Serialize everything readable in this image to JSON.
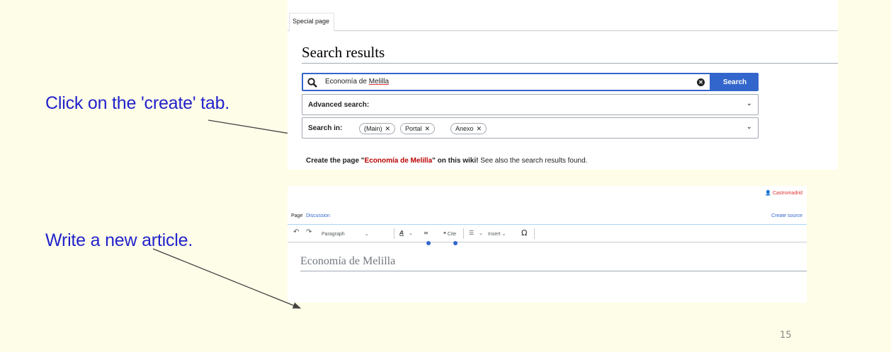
{
  "slide": {
    "caption_create": "Click on the 'create' tab.",
    "caption_write": "Write a new article.",
    "page_number": "15"
  },
  "search_screen": {
    "tab_label": "Special page",
    "heading": "Search results",
    "query_part1": "Economía de ",
    "query_part2": "Melilla",
    "search_button": "Search",
    "advanced_label": "Advanced search:",
    "search_in_label": "Search in:",
    "namespaces": [
      "(Main)",
      "Portal",
      "Anexo"
    ],
    "create_prefix": "Create the page \"",
    "create_link": "Economía de Melilla",
    "create_suffix": "\" on this wiki!",
    "create_tail": " See also the search results found."
  },
  "editor_screen": {
    "username": "Castromadrid",
    "tab_page": "Page",
    "tab_discussion": "Discussion",
    "tab_create_source": "Create source",
    "toolbar": {
      "undo": "↶",
      "redo": "↷",
      "paragraph": "Paragraph",
      "text_style": "A",
      "link": "∞",
      "cite": "Cite",
      "list": "☰",
      "insert": "Insert",
      "special_chars": "Ω"
    },
    "article_title": "Economía de Melilla"
  },
  "colors": {
    "caption": "#2222cc",
    "accent": "#3366cc",
    "redlink": "#ba0000",
    "background": "#fefde8"
  }
}
